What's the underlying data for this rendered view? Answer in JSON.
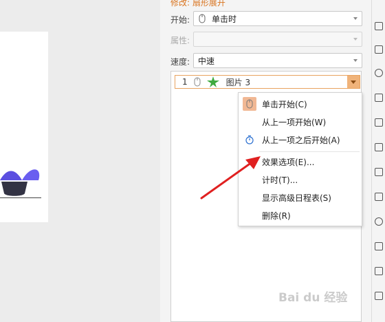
{
  "pane": {
    "title": "修改: 扇形展开",
    "start_label": "开始:",
    "start_value": "单击时",
    "property_label": "属性:",
    "property_value": "",
    "speed_label": "速度:",
    "speed_value": "中速"
  },
  "animation_item": {
    "index": "1",
    "name": "图片 3"
  },
  "context_menu": {
    "items": [
      {
        "label": "单击开始(C)",
        "icon": "mouse-click-icon"
      },
      {
        "label": "从上一项开始(W)",
        "icon": ""
      },
      {
        "label": "从上一项之后开始(A)",
        "icon": "clock-icon"
      },
      {
        "label": "效果选项(E)...",
        "icon": ""
      },
      {
        "label": "计时(T)...",
        "icon": ""
      },
      {
        "label": "显示高级日程表(S)",
        "icon": ""
      },
      {
        "label": "删除(R)",
        "icon": ""
      }
    ]
  },
  "watermark": "Bai du 经验",
  "colors": {
    "accent_orange": "#e8a25e",
    "arrow_red": "#e02020",
    "plant_purple": "#5b4fe0"
  }
}
